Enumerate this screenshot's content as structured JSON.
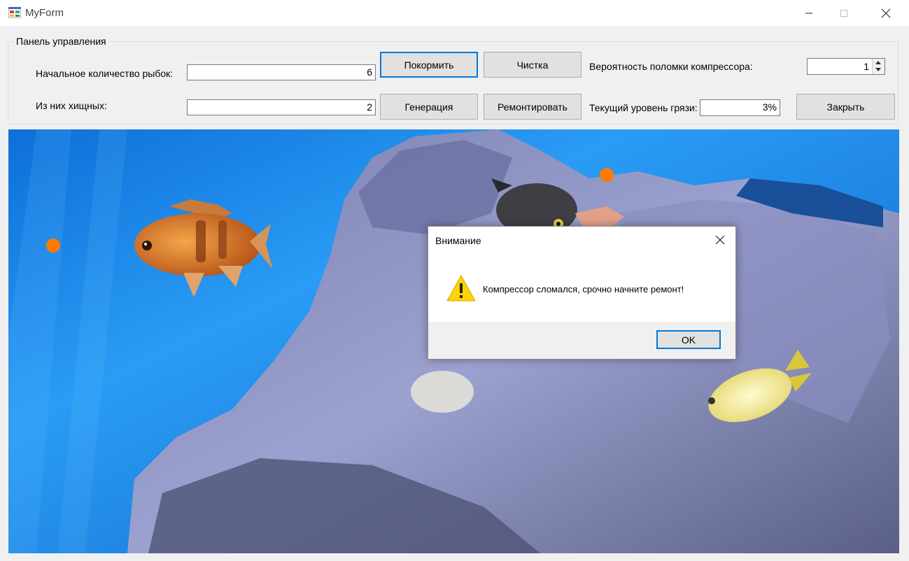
{
  "window": {
    "title": "MyForm",
    "icon": "winforms-app-icon",
    "controls": [
      "minimize-icon",
      "maximize-icon",
      "close-icon"
    ]
  },
  "panel": {
    "legend": "Панель управления",
    "initial_fish_label": "Начальное количество рыбок:",
    "initial_fish_value": "6",
    "predators_label": "Из них хищных:",
    "predators_value": "2",
    "compressor_failure_label": "Вероятность поломки компрессора:",
    "compressor_failure_value": "1",
    "dirt_level_label": "Текущий уровень грязи:",
    "dirt_level_value": "3%"
  },
  "buttons": {
    "feed": "Покормить",
    "clean": "Чистка",
    "generate": "Генерация",
    "repair": "Ремонтировать",
    "close": "Закрыть"
  },
  "dialog": {
    "title": "Внимание",
    "message": "Компрессор сломался, срочно начните ремонт!",
    "ok": "OK",
    "icon": "warning-icon"
  },
  "colors": {
    "accent": "#0078d7",
    "food_pellet": "#ff7a00",
    "water": "#1f8ef0"
  }
}
